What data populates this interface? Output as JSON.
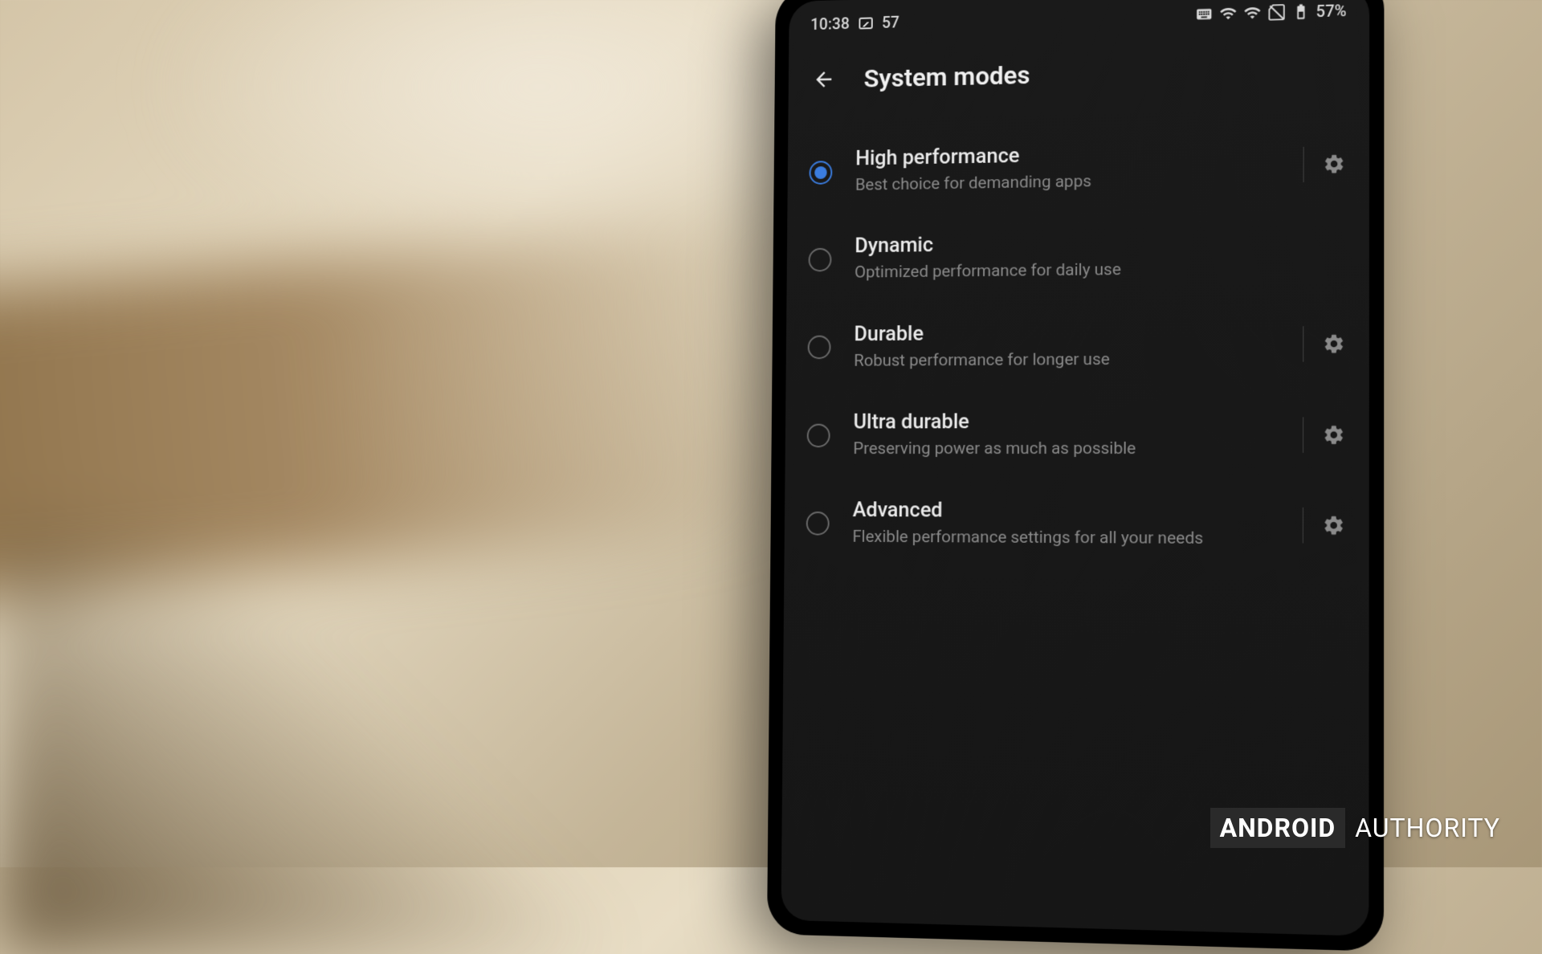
{
  "statusbar": {
    "time": "10:38",
    "notification_count": "57",
    "battery_text": "57%"
  },
  "header": {
    "title": "System modes"
  },
  "options": [
    {
      "title": "High performance",
      "desc": "Best choice for demanding apps",
      "selected": true,
      "has_gear": true
    },
    {
      "title": "Dynamic",
      "desc": "Optimized performance for daily use",
      "selected": false,
      "has_gear": false
    },
    {
      "title": "Durable",
      "desc": "Robust performance for longer use",
      "selected": false,
      "has_gear": true
    },
    {
      "title": "Ultra durable",
      "desc": "Preserving power as much as possible",
      "selected": false,
      "has_gear": true
    },
    {
      "title": "Advanced",
      "desc": "Flexible performance settings for all your needs",
      "selected": false,
      "has_gear": true
    }
  ],
  "watermark": {
    "brand": "ANDROID",
    "suffix": "AUTHORITY"
  }
}
